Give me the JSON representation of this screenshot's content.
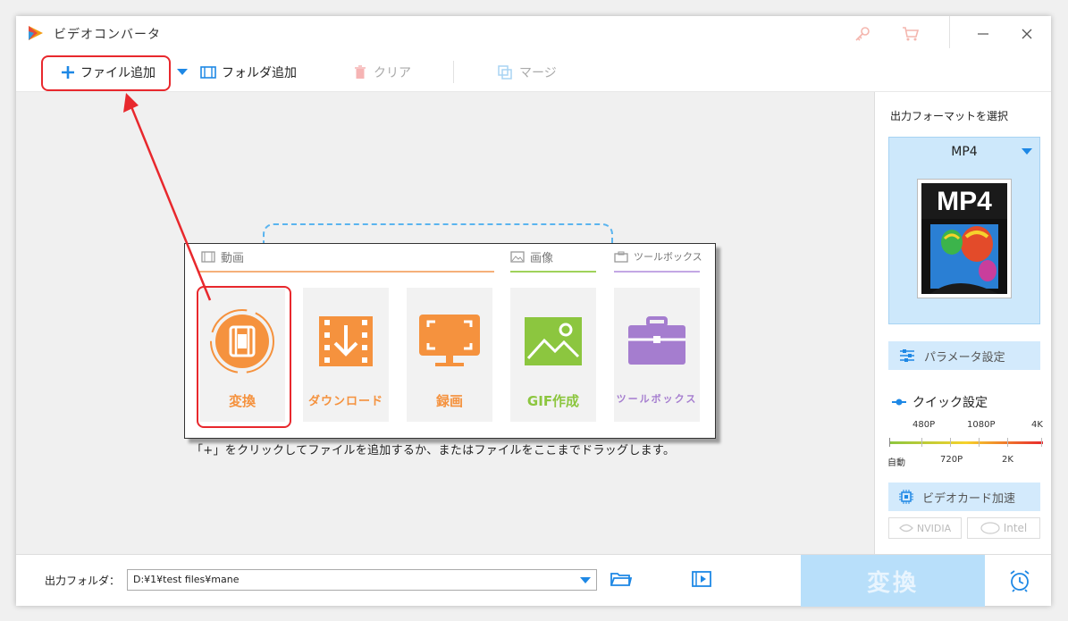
{
  "window": {
    "title": "ビデオコンバータ"
  },
  "toolbar": {
    "add_file_label": "ファイル追加",
    "add_folder_label": "フォルダ追加",
    "clear_label": "クリア",
    "merge_label": "マージ"
  },
  "popup": {
    "categories": {
      "video": "動画",
      "image": "画像",
      "toolbox": "ツールボックス"
    },
    "tiles": {
      "convert": "変換",
      "download": "ダウンロード",
      "record": "録画",
      "gif": "GIF作成",
      "toolbox": "ツールボックス"
    }
  },
  "main": {
    "hint": "「+」をクリックしてファイルを追加するか、またはファイルをここまでドラッグします。"
  },
  "right_panel": {
    "format_label": "出力フォーマットを選択",
    "format_name": "MP4",
    "format_thumb_text": "MP4",
    "param_label": "パラメータ設定",
    "quick_label": "クイック設定",
    "quality_top": [
      "480P",
      "1080P",
      "4K"
    ],
    "quality_bottom": [
      "自動",
      "720P",
      "2K"
    ],
    "gpu_label": "ビデオカード加速",
    "gpu_options": [
      "NVIDIA",
      "Intel"
    ]
  },
  "bottom": {
    "output_label": "出力フォルダ：",
    "output_path": "D:¥1¥test files¥mane",
    "convert_label": "変換"
  },
  "colors": {
    "accent_blue": "#1e88e5",
    "highlight_red": "#e8282d",
    "video_orange": "#f5923e",
    "image_green": "#8cc63f",
    "toolbox_purple": "#a57dcf"
  }
}
